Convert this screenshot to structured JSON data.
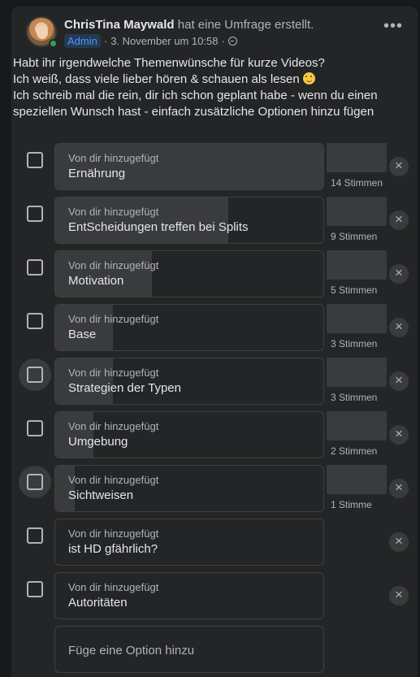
{
  "post": {
    "author": "ChrisTina Maywald",
    "action": "hat eine Umfrage erstellt.",
    "badge": "Admin",
    "date": "3. November um 10:58",
    "separator": "·",
    "audience_icon": "globe-icon",
    "more_icon": "more-horizontal-icon",
    "more_glyph": "•••",
    "text_lines": [
      "Habt ihr irgendwelche Themenwünsche für kurze Videos?",
      "Ich weiß, dass viele lieber hören & schauen als lesen",
      "Ich schreib mal die rein, dir ich schon geplant habe - wenn du einen",
      "speziellen Wunsch hast - einfach zusätzliche Optionen hinzu fügen"
    ],
    "emoji_icon": "smiling-face-icon"
  },
  "poll": {
    "options": [
      {
        "added_by": "Von dir hinzugefügt",
        "label": "Ernährung",
        "votes": "14 Stimmen",
        "share": 1.0,
        "has_voters": true,
        "hovered": false
      },
      {
        "added_by": "Von dir hinzugefügt",
        "label": "EntScheidungen treffen bei Splits",
        "votes": "9 Stimmen",
        "share": 0.643,
        "has_voters": true,
        "hovered": false
      },
      {
        "added_by": "Von dir hinzugefügt",
        "label": "Motivation",
        "votes": "5 Stimmen",
        "share": 0.357,
        "has_voters": true,
        "hovered": false
      },
      {
        "added_by": "Von dir hinzugefügt",
        "label": "Base",
        "votes": "3 Stimmen",
        "share": 0.214,
        "has_voters": true,
        "hovered": false
      },
      {
        "added_by": "Von dir hinzugefügt",
        "label": "Strategien der Typen",
        "votes": "3 Stimmen",
        "share": 0.214,
        "has_voters": true,
        "hovered": true
      },
      {
        "added_by": "Von dir hinzugefügt",
        "label": "Umgebung",
        "votes": "2 Stimmen",
        "share": 0.143,
        "has_voters": true,
        "hovered": false
      },
      {
        "added_by": "Von dir hinzugefügt",
        "label": "Sichtweisen",
        "votes": "1 Stimme",
        "share": 0.071,
        "has_voters": true,
        "hovered": true
      },
      {
        "added_by": "Von dir hinzugefügt",
        "label": "ist HD gfährlich?",
        "votes": "",
        "share": 0,
        "has_voters": false,
        "hovered": false
      },
      {
        "added_by": "Von dir hinzugefügt",
        "label": "Autoritäten",
        "votes": "",
        "share": 0,
        "has_voters": false,
        "hovered": false
      }
    ],
    "remove_icon": "close-icon",
    "remove_glyph": "×",
    "add_option_placeholder": "Füge eine Option hinzu"
  }
}
